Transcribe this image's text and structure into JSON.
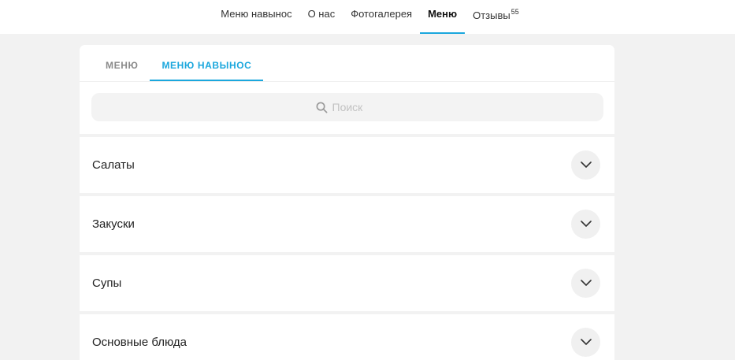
{
  "topnav": {
    "items": [
      {
        "label": "Меню навынос",
        "active": false
      },
      {
        "label": "О нас",
        "active": false
      },
      {
        "label": "Фотогалерея",
        "active": false
      },
      {
        "label": "Меню",
        "active": true
      },
      {
        "label": "Отзывы",
        "badge": "55",
        "active": false
      }
    ]
  },
  "tabs": [
    {
      "label": "МЕНЮ",
      "active": false
    },
    {
      "label": "МЕНЮ НАВЫНОС",
      "active": true
    }
  ],
  "search": {
    "placeholder": "Поиск",
    "icon": "search-icon"
  },
  "sections": [
    {
      "title": "Салаты",
      "icon": "chevron-down-icon"
    },
    {
      "title": "Закуски",
      "icon": "chevron-down-icon"
    },
    {
      "title": "Супы",
      "icon": "chevron-down-icon"
    },
    {
      "title": "Основные блюда",
      "icon": "chevron-down-icon"
    }
  ],
  "colors": {
    "accent": "#1ba7dd",
    "background": "#f2f2f2",
    "card": "#ffffff"
  }
}
